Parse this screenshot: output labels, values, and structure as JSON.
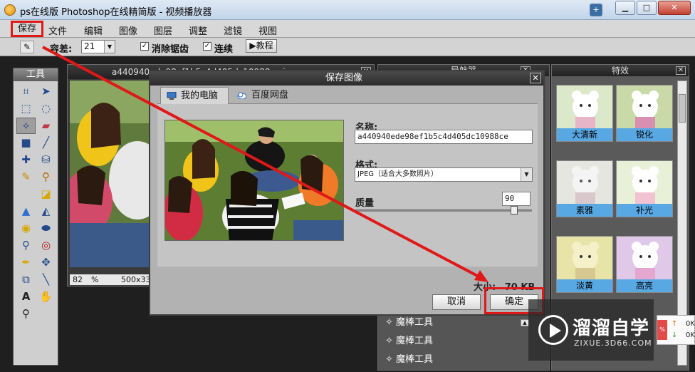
{
  "window": {
    "title": "ps在线版 Photoshop在线精简版 - 视频播放器",
    "buttons": {
      "minimize": "▁",
      "maximize": "□",
      "close": "✕",
      "pin": "+"
    }
  },
  "menu": {
    "save": "保存",
    "items": [
      "文件",
      "编辑",
      "图像",
      "图层",
      "调整",
      "滤镜",
      "视图"
    ]
  },
  "options": {
    "tolerance_label": "容差:",
    "tolerance_value": "21",
    "antialias_label": "消除锯齿",
    "contiguous_label": "连续",
    "tutorial_label": "教程"
  },
  "toolbox": {
    "title": "工具",
    "tools": [
      "crop-icon",
      "move-icon",
      "marquee-icon",
      "lasso-icon",
      "magic-wand-icon",
      "eraser-icon",
      "rectangle-icon",
      "brush-icon",
      "healing-icon",
      "bucket-icon",
      "pencil-icon",
      "stamp-icon",
      "shape-icon",
      "blur-icon",
      "sharpen-icon",
      "dodge-icon",
      "sponge-icon",
      "zoom-icon",
      "smudge-icon",
      "eye-icon",
      "pen-icon",
      "transform-icon",
      "warp-icon",
      "dropper-icon",
      "text-icon",
      "hand-icon",
      "magnifier-icon"
    ]
  },
  "document": {
    "filename": "a440940ede98ef1b5c4d405dc10988ce.jpg",
    "zoom": "82",
    "zoom_unit": "%",
    "size": "500x33"
  },
  "navigator": {
    "title": "导航器",
    "tool_items": [
      "魔棒工具",
      "魔棒工具",
      "魔棒工具"
    ]
  },
  "effects": {
    "title": "特效",
    "items": [
      "大清新",
      "锐化",
      "素雅",
      "补光",
      "淡黄",
      "高亮"
    ]
  },
  "dialog": {
    "title": "保存图像",
    "tab_active": "我的电脑",
    "tab_inactive": "百度网盘",
    "name_label": "名称:",
    "name_value": "a440940ede98ef1b5c4d405dc10988ce",
    "format_label": "格式:",
    "format_value": "JPEG（适合大多数照片）",
    "quality_label": "质量",
    "quality_value": "90",
    "quality_fraction": 0.9,
    "size_label": "大小:",
    "size_value": "70 KB",
    "cancel": "取消",
    "ok": "确定"
  },
  "watermark": {
    "title": "溜溜自学",
    "url": "ZIXUE.3D66.COM"
  },
  "netspeed": {
    "percent": "%",
    "up": "0K",
    "down": "0K"
  },
  "colors": {
    "highlight": "#e01818",
    "effect_label": "#58a8e3"
  }
}
